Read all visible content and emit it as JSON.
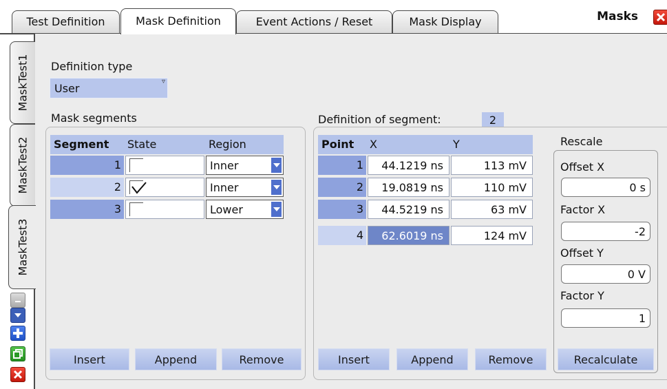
{
  "app_title": "Masks",
  "tabs": [
    {
      "label": "Test Definition"
    },
    {
      "label": "Mask Definition"
    },
    {
      "label": "Event Actions / Reset"
    },
    {
      "label": "Mask Display"
    }
  ],
  "side_tabs": [
    {
      "label": "MaskTest1"
    },
    {
      "label": "MaskTest2"
    },
    {
      "label": "MaskTest3"
    }
  ],
  "definition_type": {
    "label": "Definition type",
    "value": "User"
  },
  "mask_segments": {
    "label": "Mask segments",
    "headers": {
      "segment": "Segment",
      "state": "State",
      "region": "Region"
    },
    "rows": [
      {
        "segment": "1",
        "checked": false,
        "region": "Inner"
      },
      {
        "segment": "2",
        "checked": true,
        "region": "Inner"
      },
      {
        "segment": "3",
        "checked": false,
        "region": "Lower"
      }
    ],
    "buttons": {
      "insert": "Insert",
      "append": "Append",
      "remove": "Remove"
    }
  },
  "segment_definition": {
    "label": "Definition of segment:",
    "segment_number": "2",
    "headers": {
      "point": "Point",
      "x": "X",
      "y": "Y"
    },
    "rows": [
      {
        "point": "1",
        "x": "44.1219 ns",
        "y": "113 mV"
      },
      {
        "point": "2",
        "x": "19.0819 ns",
        "y": "110 mV"
      },
      {
        "point": "3",
        "x": "44.5219 ns",
        "y": "63 mV"
      },
      {
        "point": "4",
        "x": "62.6019 ns",
        "y": "124 mV"
      }
    ],
    "selected_row": 4,
    "buttons": {
      "insert": "Insert",
      "append": "Append",
      "remove": "Remove"
    }
  },
  "rescale": {
    "title": "Rescale",
    "offset_x": {
      "label": "Offset X",
      "value": "0 s"
    },
    "factor_x": {
      "label": "Factor X",
      "value": "-2"
    },
    "offset_y": {
      "label": "Offset Y",
      "value": "0 V"
    },
    "factor_y": {
      "label": "Factor Y",
      "value": "1"
    },
    "recalculate": "Recalculate"
  },
  "icons": [
    "close-icon",
    "scroll-up-icon",
    "scroll-down-icon",
    "add-icon",
    "copy-icon",
    "delete-icon"
  ],
  "colors": {
    "header": "#b4c3ea",
    "index": "#8ea2dd",
    "selected_cell": "#6e86c8",
    "close": "#e0261a",
    "add": "#2d63d6",
    "copy": "#2f9e2a"
  }
}
